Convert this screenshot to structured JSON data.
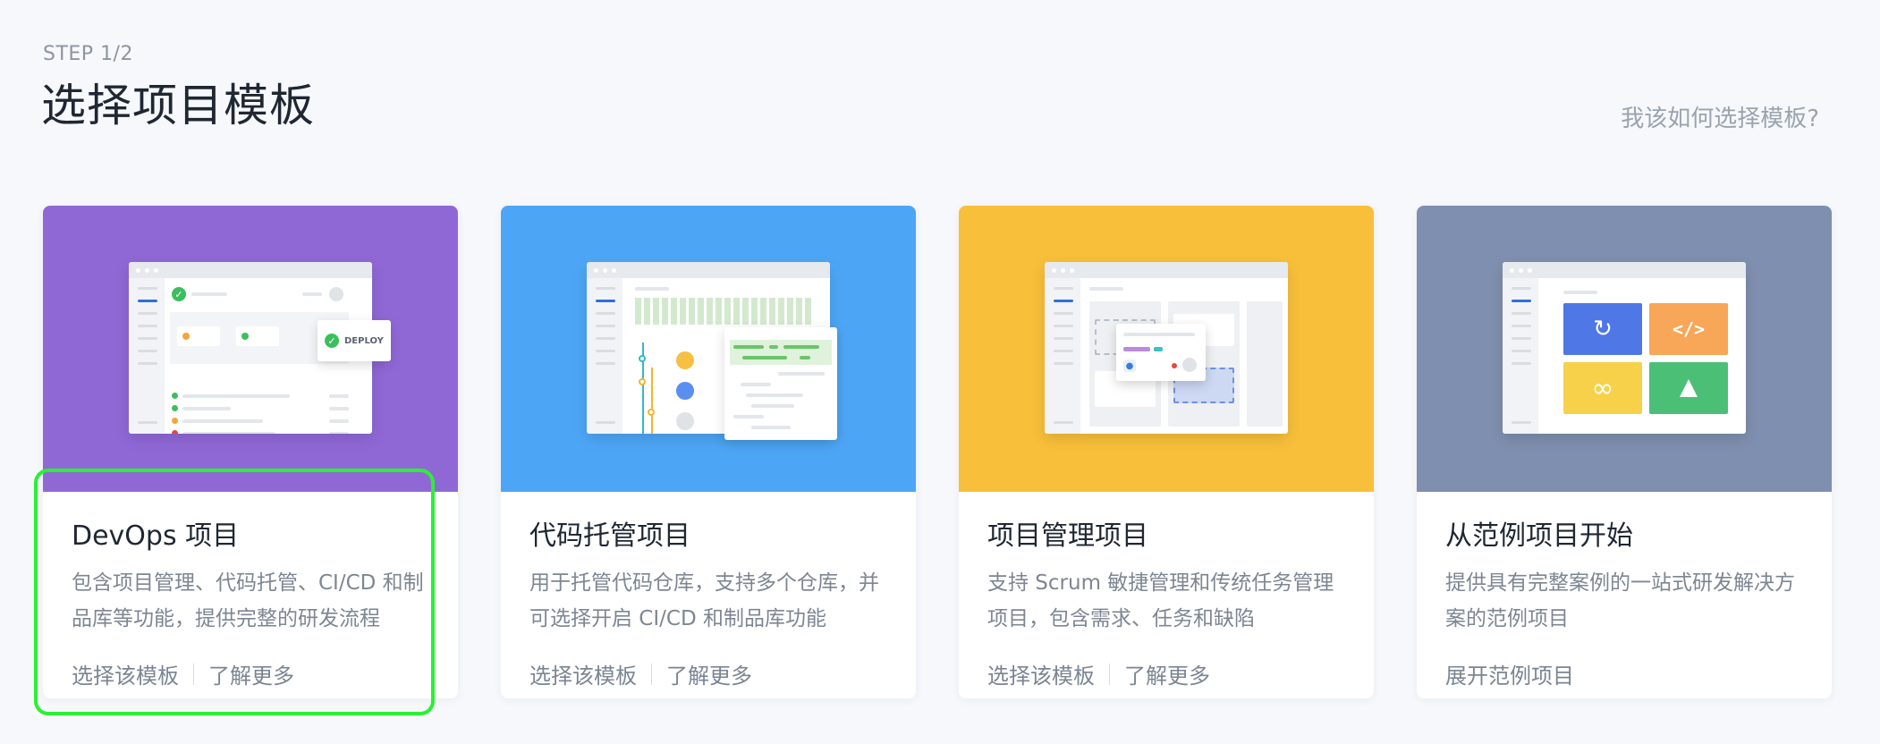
{
  "header": {
    "step": "STEP 1/2",
    "title": "选择项目模板",
    "help_link": "我该如何选择模板?"
  },
  "cards": [
    {
      "title": "DevOps 项目",
      "desc": "包含项目管理、代码托管、CI/CD 和制品库等功能，提供完整的研发流程",
      "action_primary": "选择该模板",
      "action_secondary": "了解更多",
      "hero_color": "#9068d6",
      "badge": "DEPLOY"
    },
    {
      "title": "代码托管项目",
      "desc": "用于托管代码仓库，支持多个仓库，并可选择开启 CI/CD 和制品库功能",
      "action_primary": "选择该模板",
      "action_secondary": "了解更多",
      "hero_color": "#4da6f5"
    },
    {
      "title": "项目管理项目",
      "desc": "支持 Scrum 敏捷管理和传统任务管理项目，包含需求、任务和缺陷",
      "action_primary": "选择该模板",
      "action_secondary": "了解更多",
      "hero_color": "#f8bf3a"
    },
    {
      "title": "从范例项目开始",
      "desc": "提供具有完整案例的一站式研发解决方案的范例项目",
      "action_primary": "展开范例项目",
      "hero_color": "#7f8faf"
    }
  ],
  "colors": {
    "highlight": "#2bf034",
    "tile_blue": "#4f78e6",
    "tile_orange": "#f8a657",
    "tile_yellow": "#f8d14a",
    "tile_green": "#4cbf77"
  }
}
